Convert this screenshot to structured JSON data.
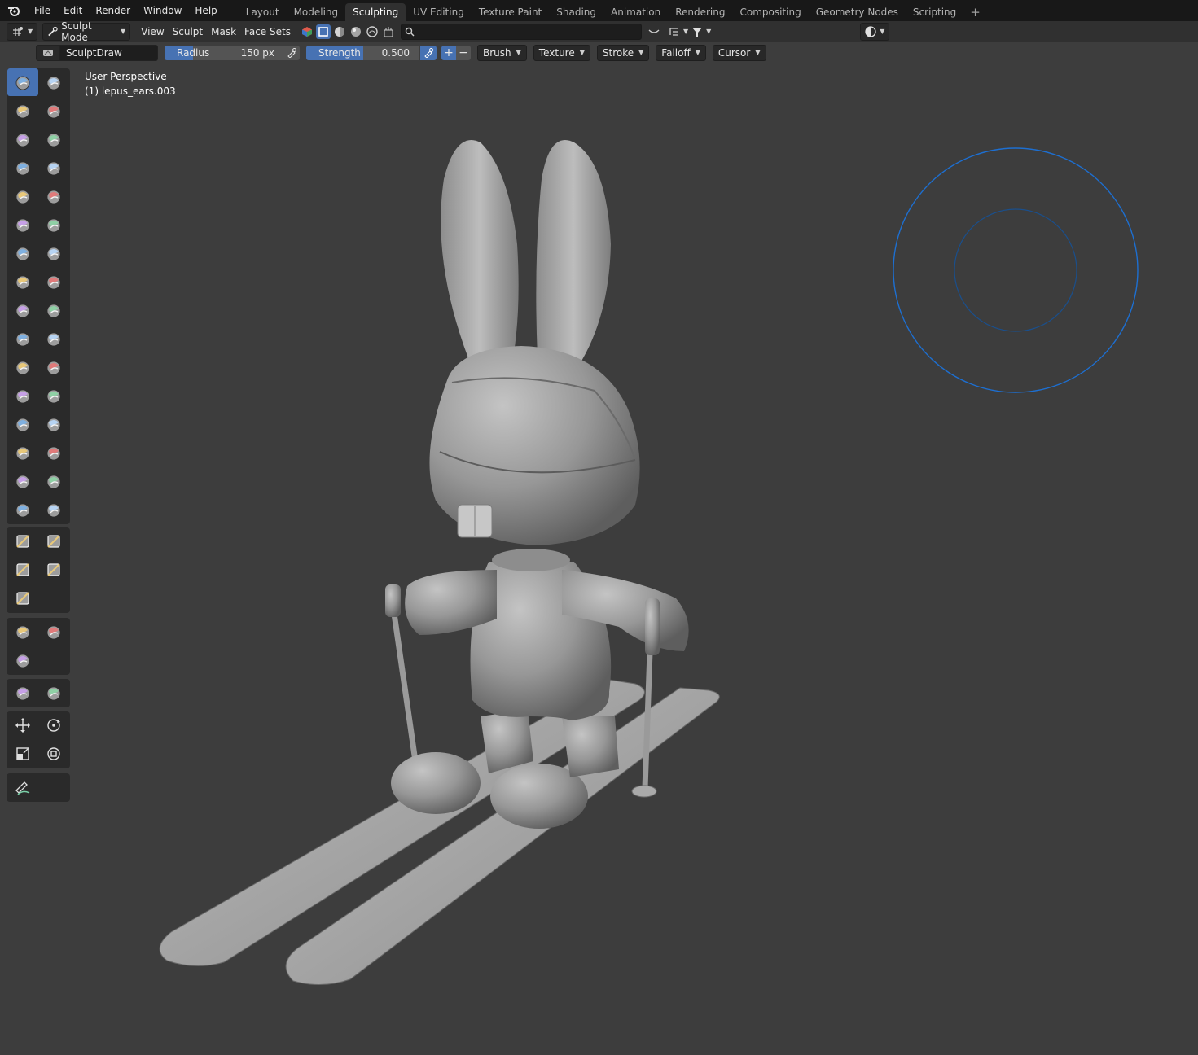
{
  "menubar": {
    "items": [
      "File",
      "Edit",
      "Render",
      "Window",
      "Help"
    ],
    "workspaces": [
      "Layout",
      "Modeling",
      "Sculpting",
      "UV Editing",
      "Texture Paint",
      "Shading",
      "Animation",
      "Rendering",
      "Compositing",
      "Geometry Nodes",
      "Scripting"
    ],
    "active_workspace": "Sculpting",
    "add_tab": "+"
  },
  "header": {
    "mode_label": "Sculpt Mode",
    "menus": [
      "View",
      "Sculpt",
      "Mask",
      "Face Sets"
    ]
  },
  "tool_settings": {
    "brush_name": "SculptDraw",
    "radius_label": "Radius",
    "radius_value": "150 px",
    "strength_label": "Strength",
    "strength_value": "0.500",
    "strength_fraction": 0.5,
    "direction_add": "+",
    "direction_subtract": "−",
    "dropdowns": [
      "Brush",
      "Texture",
      "Stroke",
      "Falloff",
      "Cursor"
    ]
  },
  "viewport": {
    "view_name": "User Perspective",
    "object_name": "(1) lepus_ears.003"
  },
  "colors": {
    "accent": "#4772b3",
    "viewport_bg": "#3d3d3d",
    "topbar_bg": "#181818",
    "header_bg": "#303030",
    "brush_cursor": "#1d6fd1"
  },
  "toolbar": {
    "brush_icons": [
      "draw-icon",
      "draw-sharp-icon",
      "clay-icon",
      "clay-strips-icon",
      "clay-thumb-icon",
      "layer-icon",
      "inflate-icon",
      "blob-icon",
      "crease-icon",
      "smooth-icon",
      "flatten-icon",
      "fill-icon",
      "scrape-icon",
      "multiplane-scrape-icon",
      "pinch-icon",
      "grab-icon",
      "elastic-deform-icon",
      "snake-hook-icon",
      "thumb-icon",
      "pose-icon",
      "nudge-icon",
      "rotate-icon",
      "slide-relax-icon",
      "boundary-icon",
      "cloth-icon",
      "simplify-icon",
      "mask-icon",
      "draw-face-sets-icon",
      "multires-displacement-eraser-icon",
      "multires-displacement-smear-icon",
      "paint-icon",
      "smear-icon"
    ],
    "gesture_icons": [
      "box-mask-icon",
      "box-hide-icon",
      "box-face-set-icon",
      "box-trim-icon",
      "line-project-icon"
    ],
    "filter_icons": [
      "mesh-filter-icon",
      "cloth-filter-icon",
      "color-filter-icon"
    ],
    "edit_icons": [
      "edit-face-set-icon",
      "mask-by-color-icon"
    ],
    "transform_icons": [
      "move-icon",
      "rotate-transform-icon",
      "scale-icon",
      "transform-icon"
    ],
    "annotate_icon": "annotate-icon"
  }
}
